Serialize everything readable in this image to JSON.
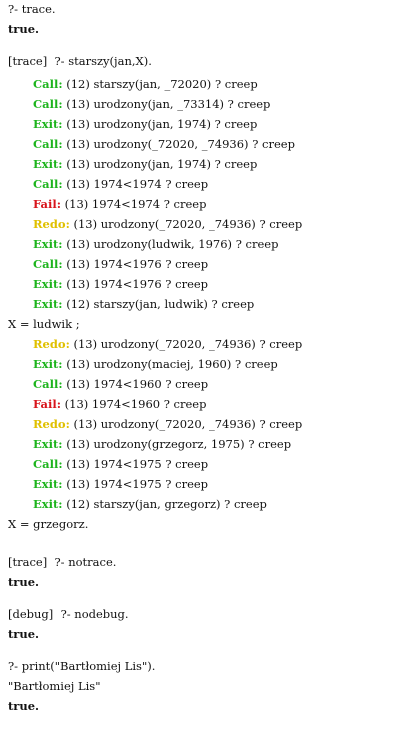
{
  "colors": {
    "call_exit": "#1db41d",
    "fail": "#d8141c",
    "redo": "#e0c000"
  },
  "lines": [
    {
      "text": "?- trace."
    },
    {
      "text": "true."
    },
    {
      "text": "[trace]  ?- starszy(jan,X)."
    },
    {
      "port": "Call:",
      "text": " (12) starszy(jan, _72020) ? creep"
    },
    {
      "port": "Call:",
      "text": " (13) urodzony(jan, _73314) ? creep"
    },
    {
      "port": "Exit:",
      "text": " (13) urodzony(jan, 1974) ? creep"
    },
    {
      "port": "Call:",
      "text": " (13) urodzony(_72020, _74936) ? creep"
    },
    {
      "port": "Exit:",
      "text": " (13) urodzony(jan, 1974) ? creep"
    },
    {
      "port": "Call:",
      "text": " (13) 1974<1974 ? creep"
    },
    {
      "port": "Fail:",
      "text": " (13) 1974<1974 ? creep"
    },
    {
      "port": "Redo:",
      "text": " (13) urodzony(_72020, _74936) ? creep"
    },
    {
      "port": "Exit:",
      "text": " (13) urodzony(ludwik, 1976) ? creep"
    },
    {
      "port": "Call:",
      "text": " (13) 1974<1976 ? creep"
    },
    {
      "port": "Exit:",
      "text": " (13) 1974<1976 ? creep"
    },
    {
      "port": "Exit:",
      "text": " (12) starszy(jan, ludwik) ? creep"
    },
    {
      "text": "X = ludwik ;"
    },
    {
      "port": "Redo:",
      "text": " (13) urodzony(_72020, _74936) ? creep"
    },
    {
      "port": "Exit:",
      "text": " (13) urodzony(maciej, 1960) ? creep"
    },
    {
      "port": "Call:",
      "text": " (13) 1974<1960 ? creep"
    },
    {
      "port": "Fail:",
      "text": " (13) 1974<1960 ? creep"
    },
    {
      "port": "Redo:",
      "text": " (13) urodzony(_72020, _74936) ? creep"
    },
    {
      "port": "Exit:",
      "text": " (13) urodzony(grzegorz, 1975) ? creep"
    },
    {
      "port": "Call:",
      "text": " (13) 1974<1975 ? creep"
    },
    {
      "port": "Exit:",
      "text": " (13) 1974<1975 ? creep"
    },
    {
      "port": "Exit:",
      "text": " (12) starszy(jan, grzegorz) ? creep"
    },
    {
      "text": "X = grzegorz."
    },
    {
      "text": "[trace]  ?- notrace."
    },
    {
      "text": "true."
    },
    {
      "text": "[debug]  ?- nodebug."
    },
    {
      "text": "true."
    },
    {
      "text": "?- print(\"Bartłomiej Lis\")."
    },
    {
      "text": "\"Bartłomiej Lis\""
    },
    {
      "text": "true."
    }
  ]
}
